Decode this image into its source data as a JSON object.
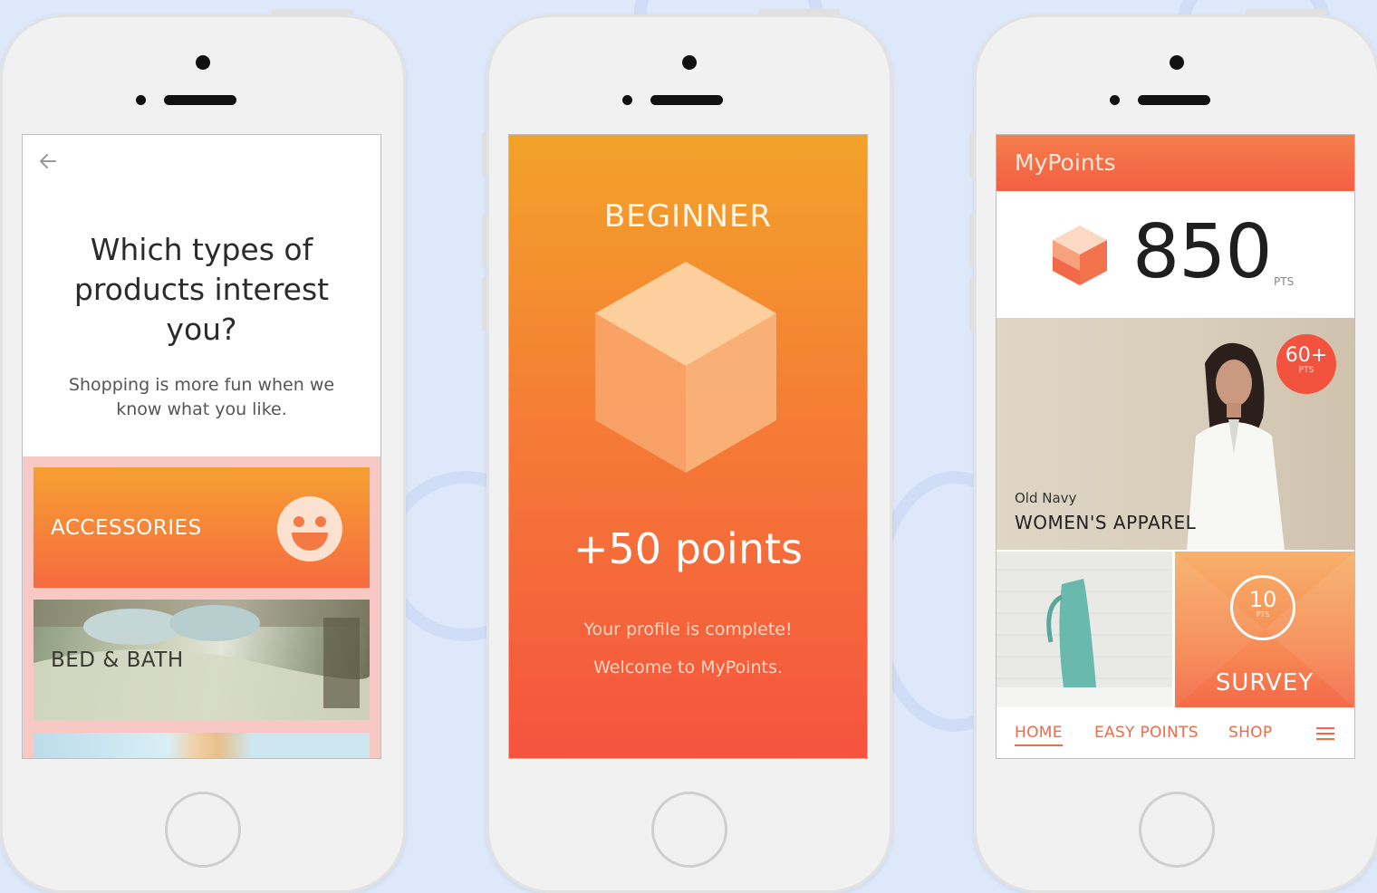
{
  "screen1": {
    "question": "Which types of products interest you?",
    "subtitle": "Shopping is more fun when we know what you like.",
    "categories": [
      {
        "label": "ACCESSORIES"
      },
      {
        "label": "BED & BATH"
      }
    ],
    "back_icon": "arrow-left-icon",
    "smile_icon": "smiley-face-icon"
  },
  "screen2": {
    "level": "BEGINNER",
    "points": "+50 points",
    "message_line1": "Your profile is complete!",
    "message_line2": "Welcome to MyPoints."
  },
  "screen3": {
    "app_title": "MyPoints",
    "points_value": "850",
    "points_unit": "PTS",
    "feature": {
      "badge_value": "60+",
      "badge_unit": "PTS",
      "brand": "Old Navy",
      "title": "WOMEN'S APPAREL"
    },
    "survey": {
      "value": "10",
      "unit": "PTS",
      "label": "SURVEY"
    },
    "nav": {
      "home": "HOME",
      "easy_points": "EASY POINTS",
      "shop": "SHOP",
      "menu_icon": "hamburger-menu-icon"
    }
  },
  "colors": {
    "background": "#dde9fa",
    "accent": "#f26a46",
    "gradient_top": "#f2a22a",
    "gradient_bottom": "#f5533f"
  }
}
